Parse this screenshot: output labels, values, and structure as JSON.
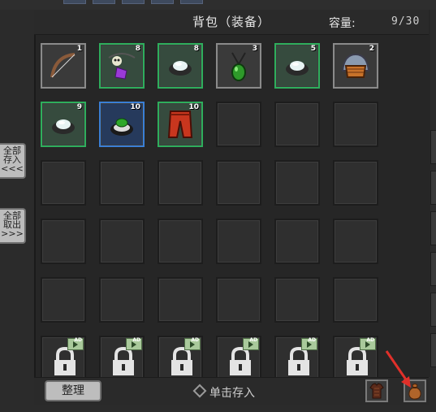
{
  "header": {
    "title": "背包（装备）",
    "capacity_label": "容量:",
    "capacity_value": "9/30"
  },
  "side_buttons": {
    "deposit_all": "全部\n存入\n<<<",
    "withdraw_all": "全部\n取出\n>>>"
  },
  "slots": [
    {
      "kind": "item",
      "rarity": "grey",
      "icon": "bow-icon",
      "count": "1"
    },
    {
      "kind": "item",
      "rarity": "green",
      "icon": "charm-icon",
      "count": "8"
    },
    {
      "kind": "item",
      "rarity": "green",
      "icon": "ring-icon",
      "count": "8"
    },
    {
      "kind": "item",
      "rarity": "grey",
      "icon": "amulet-icon",
      "count": "3"
    },
    {
      "kind": "item",
      "rarity": "green",
      "icon": "ring-icon",
      "count": "5"
    },
    {
      "kind": "item",
      "rarity": "grey",
      "icon": "helmet-icon",
      "count": "2"
    },
    {
      "kind": "item",
      "rarity": "green",
      "icon": "ring-icon",
      "count": "9"
    },
    {
      "kind": "item",
      "rarity": "blue",
      "icon": "emerald-ring-icon",
      "count": "10"
    },
    {
      "kind": "item",
      "rarity": "green",
      "icon": "pants-icon",
      "count": "10"
    },
    {
      "kind": "empty"
    },
    {
      "kind": "empty"
    },
    {
      "kind": "empty"
    },
    {
      "kind": "empty"
    },
    {
      "kind": "empty"
    },
    {
      "kind": "empty"
    },
    {
      "kind": "empty"
    },
    {
      "kind": "empty"
    },
    {
      "kind": "empty"
    },
    {
      "kind": "empty"
    },
    {
      "kind": "empty"
    },
    {
      "kind": "empty"
    },
    {
      "kind": "empty"
    },
    {
      "kind": "empty"
    },
    {
      "kind": "empty"
    },
    {
      "kind": "empty"
    },
    {
      "kind": "empty"
    },
    {
      "kind": "empty"
    },
    {
      "kind": "empty"
    },
    {
      "kind": "empty"
    },
    {
      "kind": "empty"
    },
    {
      "kind": "locked",
      "ad_label": "AD"
    },
    {
      "kind": "locked",
      "ad_label": "AD"
    },
    {
      "kind": "locked",
      "ad_label": "AD"
    },
    {
      "kind": "locked",
      "ad_label": "AD"
    },
    {
      "kind": "locked",
      "ad_label": "AD"
    },
    {
      "kind": "locked",
      "ad_label": "AD"
    }
  ],
  "footer": {
    "sort_label": "整理",
    "hint_text": "单击存入",
    "item_icons": [
      "armor-icon",
      "bag-icon"
    ]
  }
}
